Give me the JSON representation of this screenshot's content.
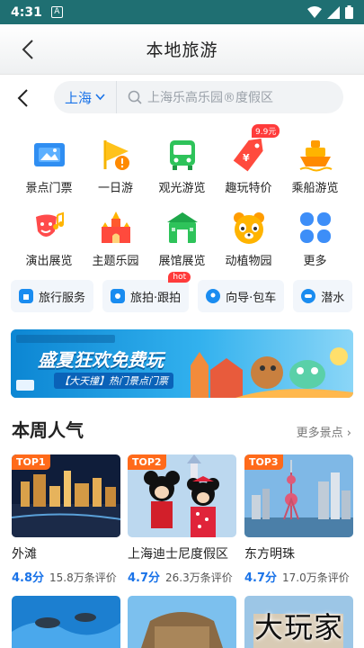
{
  "status": {
    "time": "4:31",
    "notif": "A"
  },
  "nav": {
    "title": "本地旅游"
  },
  "search": {
    "city": "上海",
    "placeholder": "上海乐高乐园®度假区"
  },
  "grid": [
    {
      "label": "景点门票",
      "icon": "ticket-icon"
    },
    {
      "label": "一日游",
      "icon": "flag-icon"
    },
    {
      "label": "观光游览",
      "icon": "bus-icon"
    },
    {
      "label": "趣玩特价",
      "icon": "price-tag-icon",
      "badge": "9.9元"
    },
    {
      "label": "乘船游览",
      "icon": "boat-icon"
    },
    {
      "label": "演出展览",
      "icon": "theater-mask-icon"
    },
    {
      "label": "主题乐园",
      "icon": "castle-icon"
    },
    {
      "label": "展馆展览",
      "icon": "museum-icon"
    },
    {
      "label": "动植物园",
      "icon": "panda-icon"
    },
    {
      "label": "更多",
      "icon": "more-grid-icon"
    }
  ],
  "pills": [
    {
      "label": "旅行服务"
    },
    {
      "label": "旅拍·跟拍",
      "badge": "hot"
    },
    {
      "label": "向导·包车"
    },
    {
      "label": "潜水"
    }
  ],
  "banner": {
    "text1": "盛夏狂欢免费玩",
    "text2": "【大天撞】热门景点门票"
  },
  "section": {
    "title": "本周人气",
    "more": "更多景点"
  },
  "cards": [
    {
      "rank": "TOP1",
      "name": "外滩",
      "score": "4.8分",
      "reviews": "15.8万条评价"
    },
    {
      "rank": "TOP2",
      "name": "上海迪士尼度假区",
      "score": "4.7分",
      "reviews": "26.3万条评价"
    },
    {
      "rank": "TOP3",
      "name": "东方明珠",
      "score": "4.7分",
      "reviews": "17.0万条评价"
    }
  ],
  "watermark": "大玩家"
}
